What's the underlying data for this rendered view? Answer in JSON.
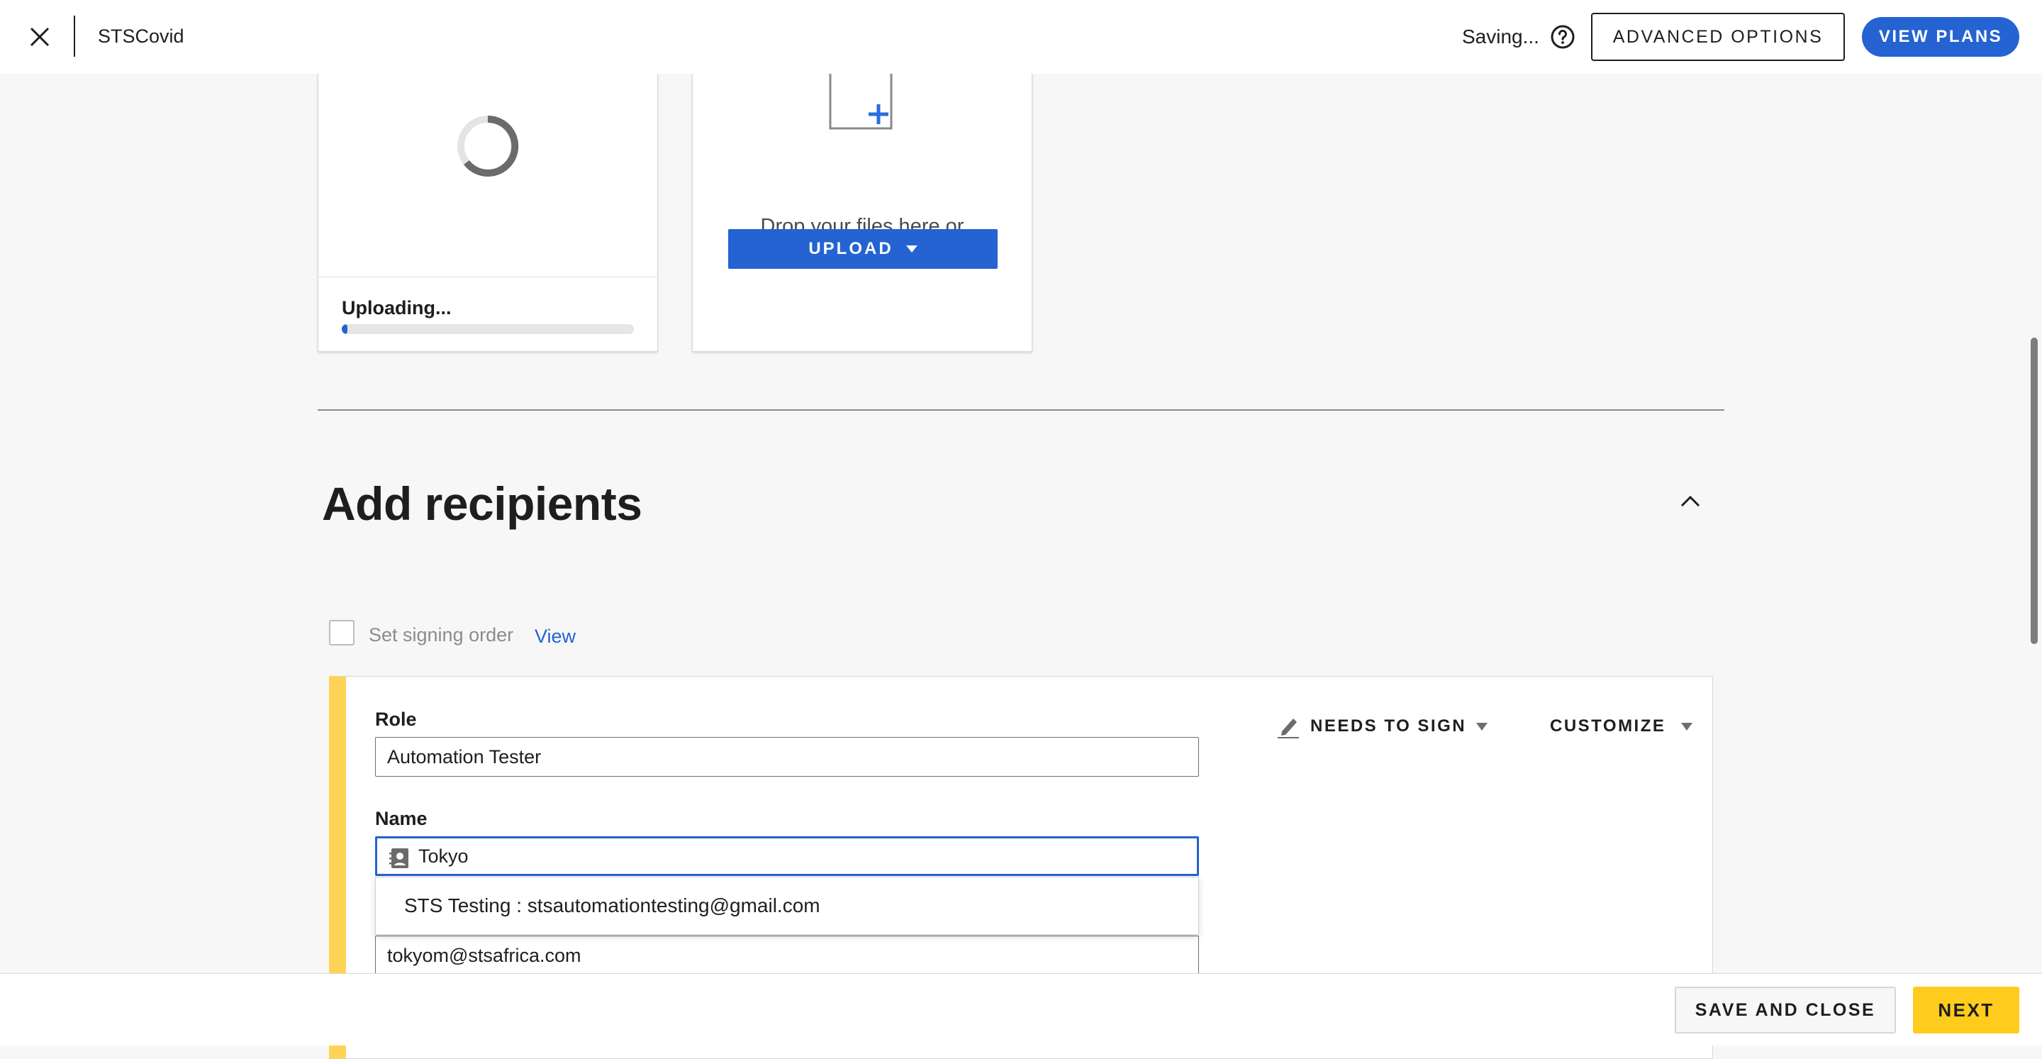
{
  "header": {
    "document_title": "STSCovid",
    "status": "Saving...",
    "advanced_options_label": "ADVANCED OPTIONS",
    "view_plans_label": "VIEW PLANS"
  },
  "upload": {
    "uploading_label": "Uploading...",
    "progress_fraction": 0.02,
    "drop_text": "Drop your files here or",
    "upload_button_label": "UPLOAD"
  },
  "recipients": {
    "section_title": "Add recipients",
    "signing_order_label": "Set signing order",
    "signing_order_checked": false,
    "view_link": "View",
    "recipient": {
      "role_label": "Role",
      "role_value": "Automation Tester",
      "name_label": "Name",
      "name_value": "Tokyo",
      "name_suggestion": "STS Testing : stsautomationtesting@gmail.com",
      "email_value": "tokyom@stsafrica.com",
      "action_label": "NEEDS TO SIGN",
      "customize_label": "CUSTOMIZE",
      "accent_color": "#ffd355"
    }
  },
  "footer": {
    "save_close_label": "SAVE AND CLOSE",
    "next_label": "NEXT"
  },
  "colors": {
    "primary": "#2463d1",
    "next_button": "#ffcc1e",
    "background": "#f7f7f7"
  }
}
